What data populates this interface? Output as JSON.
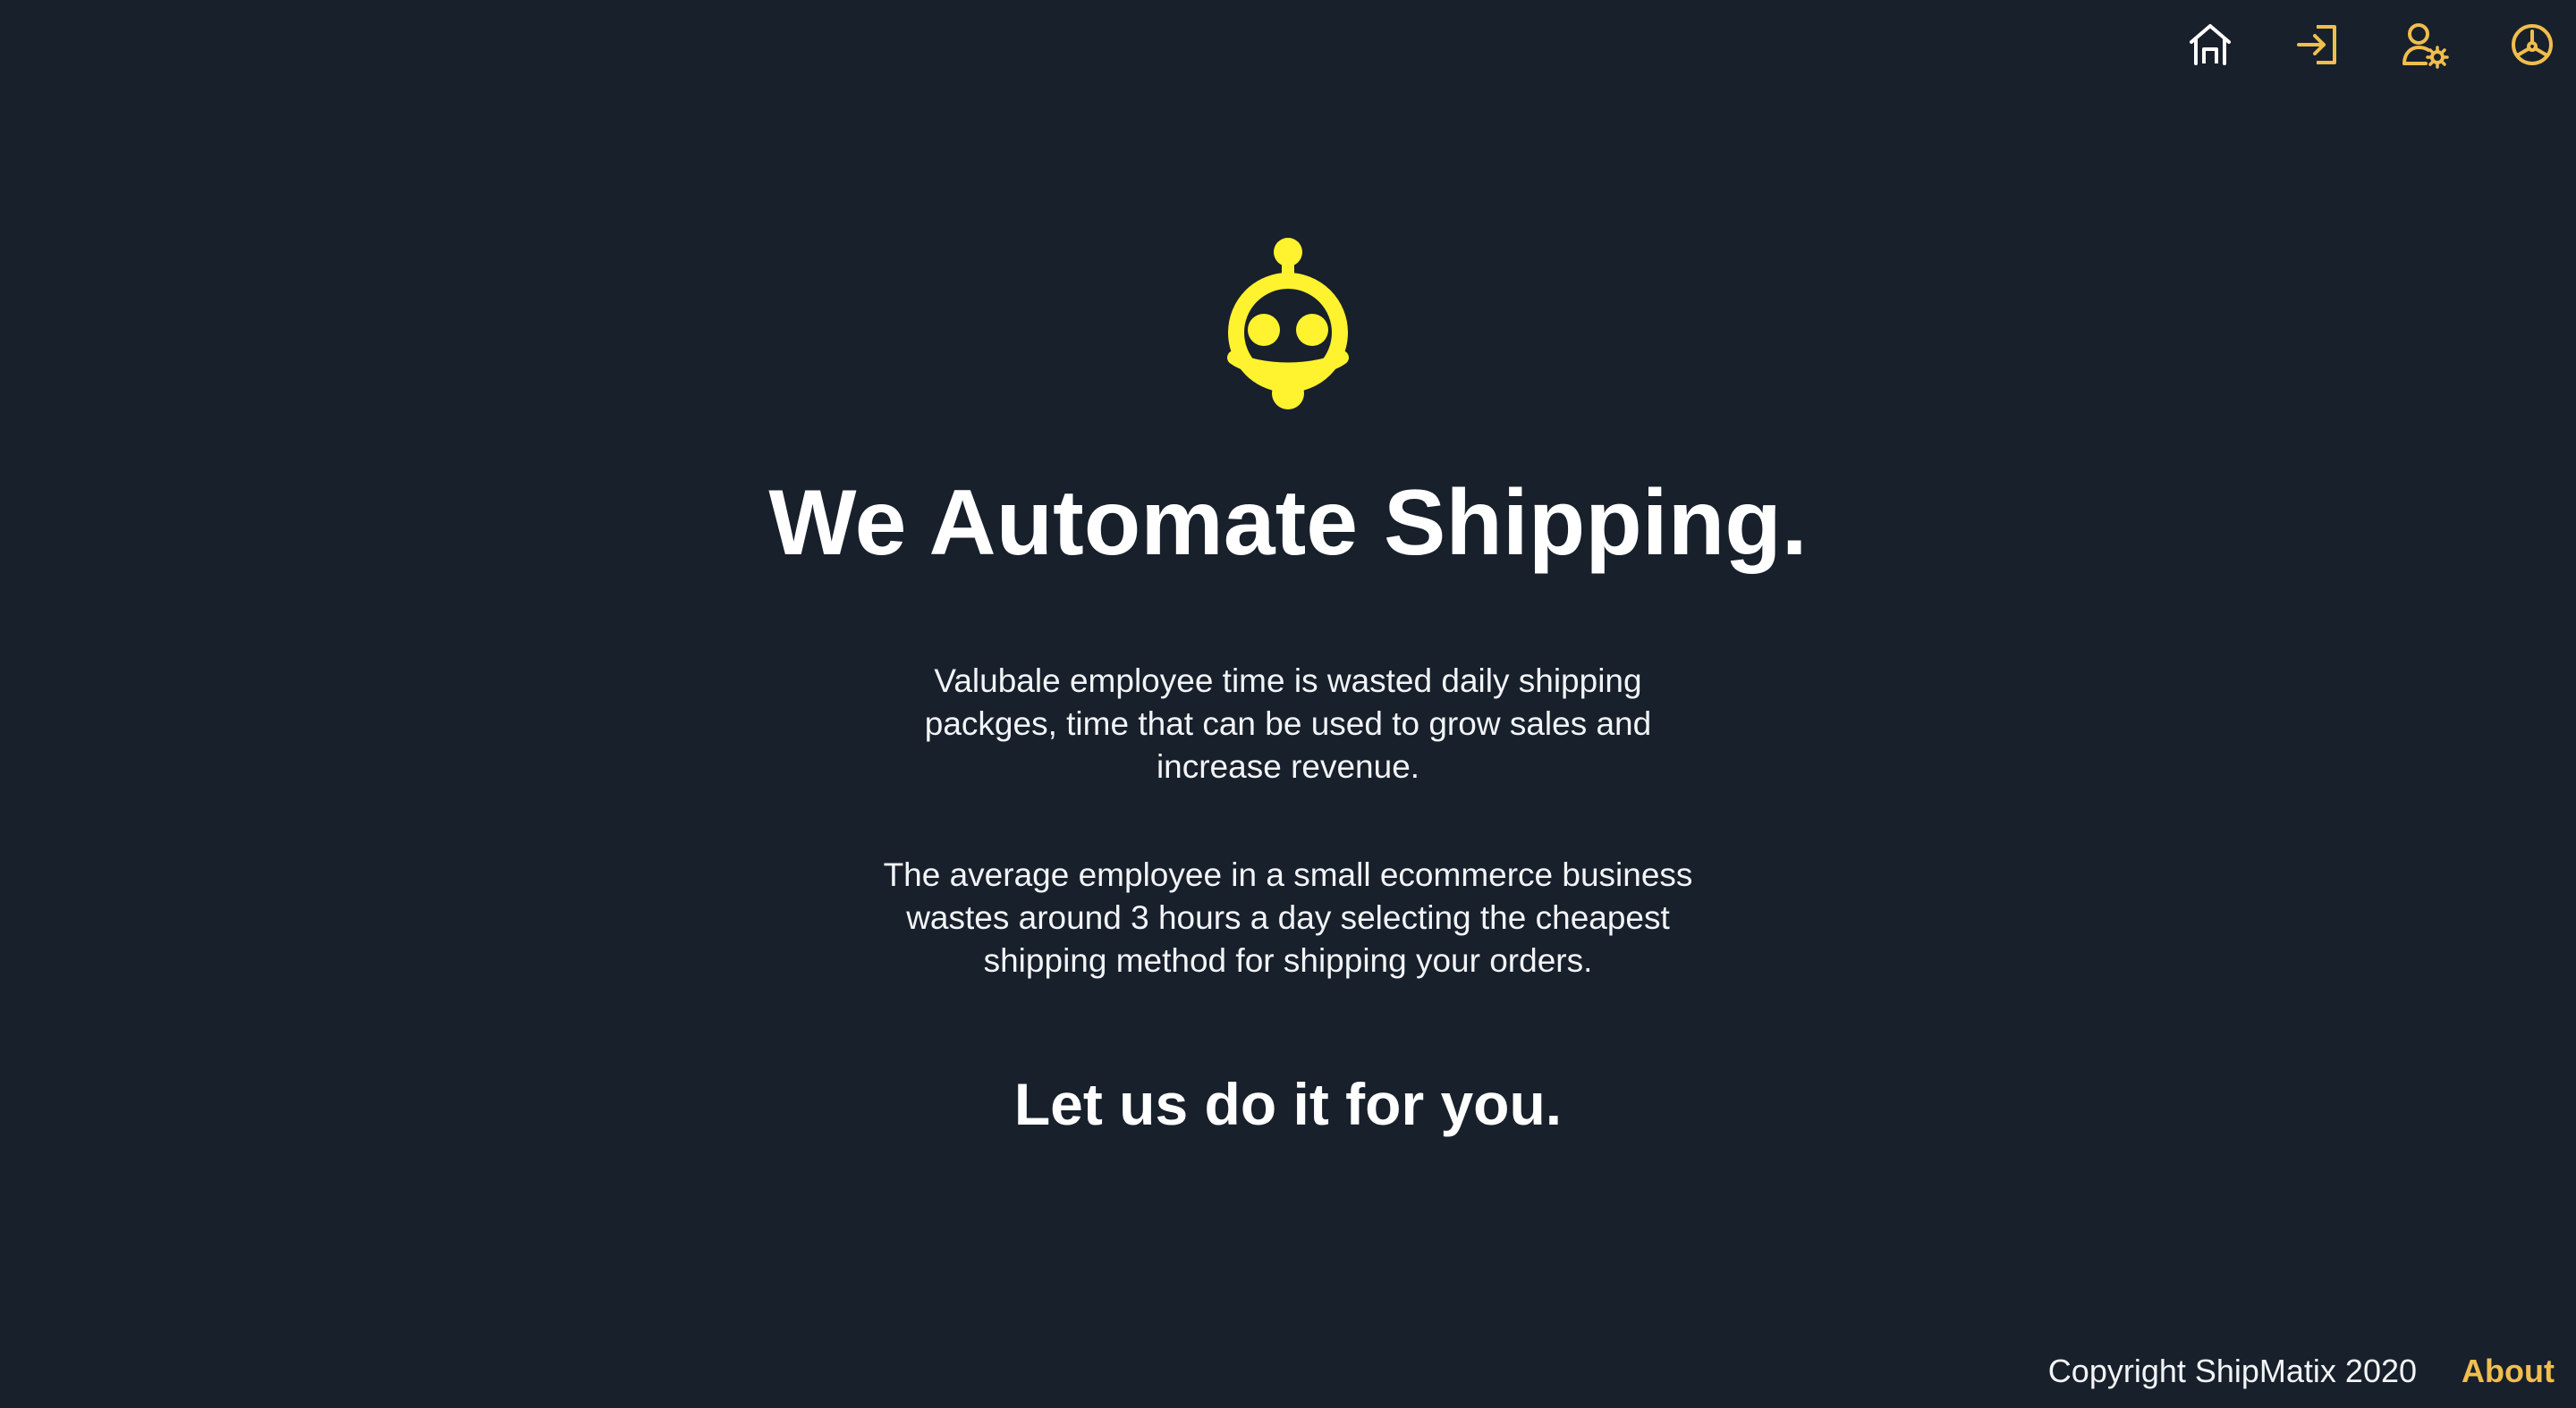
{
  "nav": {
    "items": [
      {
        "icon": "home-icon",
        "color": "#ffffff"
      },
      {
        "icon": "sign-in-icon",
        "color": "#f0be4e"
      },
      {
        "icon": "user-settings-icon",
        "color": "#f0be4e"
      },
      {
        "icon": "dashboard-gauge-icon",
        "color": "#f0be4e"
      }
    ]
  },
  "hero": {
    "logo_icon": "robot-logo-icon",
    "logo_color": "#fff22e",
    "headline": "We Automate Shipping.",
    "para1_lines": [
      "Valubale employee time is wasted daily shipping",
      "packges, time that can be used to grow sales and",
      "increase revenue."
    ],
    "para2_lines": [
      "The average employee in a small ecommerce business",
      "wastes around 3 hours a day selecting the cheapest",
      "shipping method for shipping your orders."
    ],
    "cta": "Let us do it for you."
  },
  "footer": {
    "copyright": "Copyright ShipMatix 2020",
    "about_label": "About"
  },
  "colors": {
    "background": "#18202b",
    "accent": "#f0be4e",
    "logo": "#fff22e",
    "text": "#ffffff"
  }
}
